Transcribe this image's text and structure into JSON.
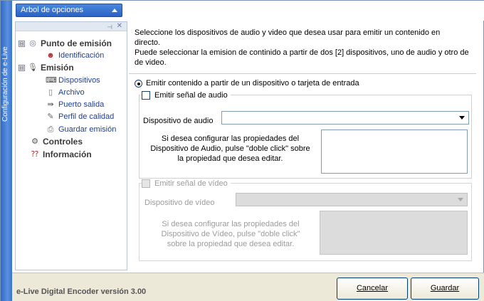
{
  "window": {
    "vertical_title": "Configuración de e-Live"
  },
  "toolbar": {
    "dropdown_label": "Arbol de opciones"
  },
  "tree": {
    "groups": [
      {
        "label": "Punto de emisión",
        "icon": "broadcast-icon",
        "expander": "⊟",
        "children": [
          {
            "label": "Identificación",
            "icon": "person-icon"
          }
        ]
      },
      {
        "label": "Emisión",
        "icon": "microphone-icon",
        "expander": "⊟",
        "children": [
          {
            "label": "Dispositivos",
            "icon": "device-icon"
          },
          {
            "label": "Archivo",
            "icon": "file-icon"
          },
          {
            "label": "Puerto salida",
            "icon": "arrow-out-icon"
          },
          {
            "label": "Perfil de calidad",
            "icon": "quality-icon"
          },
          {
            "label": "Guardar emisión",
            "icon": "save-icon"
          }
        ]
      },
      {
        "label": "Controles",
        "icon": "controls-icon"
      },
      {
        "label": "Información",
        "icon": "info-icon"
      }
    ]
  },
  "main": {
    "description_line1": "Seleccione los dispositivos de audio y video que desea usar para emitir un contenido en",
    "description_line2": "directo.",
    "description_line3": "Puede seleccionar la emision de continido a partir de dos [2] dispositivos, uno de audio y otro de",
    "description_line4": "de video.",
    "radio_label": "Emitir contenido a partir de un dispositivo o tarjeta de entrada",
    "audio": {
      "checkbox_label": "Emitir señal de audio",
      "device_label": "Dispositivo de audio",
      "device_value": "",
      "hint_line1": "Si desea configurar las propiedades del",
      "hint_line2": "Dispositivo de Audio, pulse \"doble click\" sobre",
      "hint_line3": "la propiedad que desea editar."
    },
    "video": {
      "checkbox_label": "Emitir señal de vídeo",
      "device_label": "Dispositivo de vídeo",
      "device_value": "",
      "hint_line1": "Si desea configurar las propiedades del",
      "hint_line2": "Dispositivo de Vídeo, pulse \"doble click\"",
      "hint_line3": "sobre la propiedad que desea editar."
    }
  },
  "footer": {
    "version": "e-Live Digital Encoder versión 3.00",
    "cancel_label": "Cancelar",
    "save_label": "Guardar"
  },
  "colors": {
    "title_bar": "#2e6bc6",
    "link": "#1f3f8f"
  }
}
